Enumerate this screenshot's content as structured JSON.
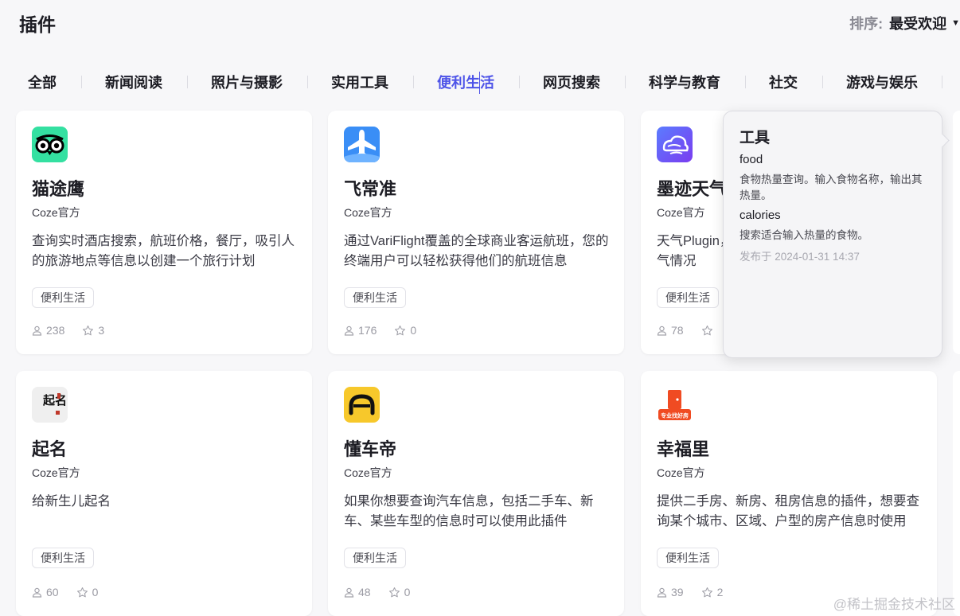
{
  "header": {
    "title": "插件",
    "sort_label": "排序:",
    "sort_value": "最受欢迎"
  },
  "tabs": [
    "全部",
    "新闻阅读",
    "照片与摄影",
    "实用工具",
    "便利生活",
    "网页搜索",
    "科学与教育",
    "社交",
    "游戏与娱乐"
  ],
  "active_tab": "便利生活",
  "cards": [
    {
      "name": "猫途鹰",
      "author": "Coze官方",
      "description": "查询实时酒店搜索，航班价格，餐厅，吸引人的旅游地点等信息以创建一个旅行计划",
      "tag": "便利生活",
      "users": "238",
      "favorites": "3",
      "icon": "tripadvisor-owl-icon"
    },
    {
      "name": "飞常准",
      "author": "Coze官方",
      "description": "通过VariFlight覆盖的全球商业客运航班，您的终端用户可以轻松获得他们的航班信息",
      "tag": "便利生活",
      "users": "176",
      "favorites": "0",
      "icon": "airplane-icon"
    },
    {
      "name": "墨迹天气",
      "author": "Coze官方",
      "description": "天气Plugin，可以查询指定城市未来几天的天气情况",
      "tag": "便利生活",
      "users": "78",
      "favorites": "",
      "icon": "cloud-icon"
    },
    {
      "name": "起名",
      "author": "Coze官方",
      "description": "给新生儿起名",
      "tag": "便利生活",
      "users": "60",
      "favorites": "0",
      "icon": "calligraphy-icon"
    },
    {
      "name": "懂车帝",
      "author": "Coze官方",
      "description": "如果你想要查询汽车信息，包括二手车、新车、某些车型的信息时可以使用此插件",
      "tag": "便利生活",
      "users": "48",
      "favorites": "0",
      "icon": "car-icon"
    },
    {
      "name": "幸福里",
      "author": "Coze官方",
      "description": "提供二手房、新房、租房信息的插件，想要查询某个城市、区域、户型的房产信息时使用",
      "tag": "便利生活",
      "users": "39",
      "favorites": "2",
      "icon": "house-door-icon"
    }
  ],
  "tooltip": {
    "title": "工具",
    "functions": [
      {
        "name": "food",
        "description": "食物热量查询。输入食物名称，输出其热量。"
      },
      {
        "name": "calories",
        "description": "搜索适合输入热量的食物。"
      }
    ],
    "published": "发布于 2024-01-31 14:37"
  },
  "icon_texts": {
    "calligraphy": "起名",
    "house_badge": "专业找好房"
  },
  "watermark": "@稀土掘金技术社区",
  "colors": {
    "accent": "#4d53e8",
    "tripadvisor": "#34e0a1",
    "airplane": "#3a8ef6",
    "moji": "#6a4cf0",
    "dongchedi": "#f7c82b",
    "xingfuli": "#f04b22"
  }
}
